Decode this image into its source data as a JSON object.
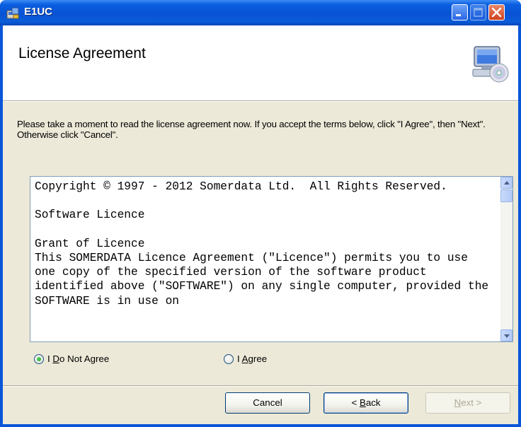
{
  "window": {
    "title": "E1UC",
    "controls": [
      "minimize-icon",
      "maximize-icon",
      "close-icon"
    ]
  },
  "header": {
    "title": "License Agreement",
    "icon": "computer-cd-icon"
  },
  "instructions": "Please take a moment to read the license agreement now. If you accept the terms below, click \"I Agree\", then \"Next\". Otherwise click \"Cancel\".",
  "license": {
    "text": "Copyright © 1997 - 2012 Somerdata Ltd.  All Rights Reserved.\n\nSoftware Licence\n\nGrant of Licence\nThis SOMERDATA Licence Agreement (\"Licence\") permits you to use one copy of the specified version of the software product identified above (\"SOFTWARE\") on any single computer, provided the SOFTWARE is in use on"
  },
  "options": {
    "do_not_agree_prefix": "I ",
    "do_not_agree_mnemonic": "D",
    "do_not_agree_rest": "o Not Agree",
    "agree_prefix": "I ",
    "agree_mnemonic": "A",
    "agree_rest": "gree",
    "selected": "I Do Not Agree"
  },
  "buttons": {
    "cancel": "Cancel",
    "back_prefix": "< ",
    "back_mnemonic": "B",
    "back_rest": "ack",
    "next_mnemonic": "N",
    "next_rest": "ext >"
  },
  "colors": {
    "titlebar": "#0a5ee0",
    "dialog_bg": "#ece9d8",
    "close_button": "#d0401c"
  }
}
